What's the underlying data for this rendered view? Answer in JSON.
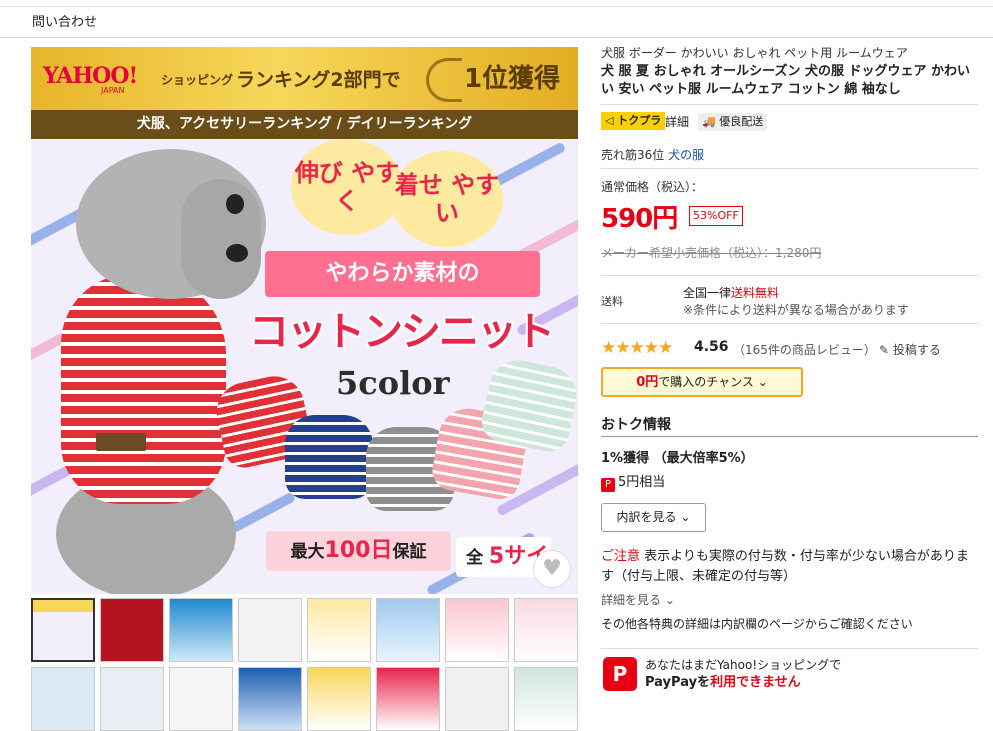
{
  "topbar": {
    "inquiry": "問い合わせ"
  },
  "banner": {
    "yahoo": "YAHOO!",
    "yahoo_sub": "JAPAN",
    "shopping": "ショッピング",
    "ranking": "ランキング2部門で",
    "first": "1位獲得",
    "categories": "犬服、アクセサリーランキング / デイリーランキング"
  },
  "hero": {
    "bubble1": "伸び やすく",
    "bubble2": "着せ やすい",
    "ribbon": "やわらか素材の",
    "title": "コットンシニット",
    "colors": "5color",
    "guarantee_pre": "最大",
    "guarantee_num": "100日",
    "guarantee_post": "保証",
    "sizes_pre": "全",
    "sizes_num": "5サイ"
  },
  "product": {
    "subtitle": "犬服 ボーダー かわいい おしゃれ ペット用 ルームウェア",
    "title": "犬 服 夏 おしゃれ オールシーズン 犬の服 ドッグウェア かわいい 安い ペット服 ルームウェア コットン 綿 袖なし",
    "tag_tokupura": "トクプラ",
    "tag_detail": "詳細",
    "tag_ship": "優良配送",
    "rank_text": "売れ筋36位",
    "rank_link": "犬の服",
    "price_label": "通常価格（税込）：",
    "price": "590円",
    "discount": "53%OFF",
    "msrp": "メーカー希望小売価格（税込）：1,280円",
    "shipping_label": "送料",
    "shipping_line1_pre": "全国一律",
    "shipping_line1_red": "送料無料",
    "shipping_line2": "※条件により送料が異なる場合があります",
    "stars": "★★★★★",
    "rating": "4.56",
    "review_count": "（165件の商品レビュー）",
    "post_review": "投稿する",
    "chance_amount": "0円",
    "chance_text": "で購入のチャンス",
    "otoku_heading": "おトク情報",
    "percent": "1%獲得 （最大倍率5%）",
    "pay_amount": "5円相当",
    "detail_button": "内訳を見る",
    "caution_red": "ご注意",
    "caution_text": "表示よりも実際の付与数・付与率が少ない場合があります（付与上限、未確定の付与等）",
    "more": "詳細を見る",
    "other": "その他各特典の詳細は内訳欄のページからご確認ください",
    "paypay_line1": "あなたはまだYahoo!ショッピングで",
    "paypay_line2_pre": "PayPayを",
    "paypay_line2_red": "利用できません"
  },
  "colors": {
    "accent": "#e60012",
    "gold": "#f5a623"
  }
}
